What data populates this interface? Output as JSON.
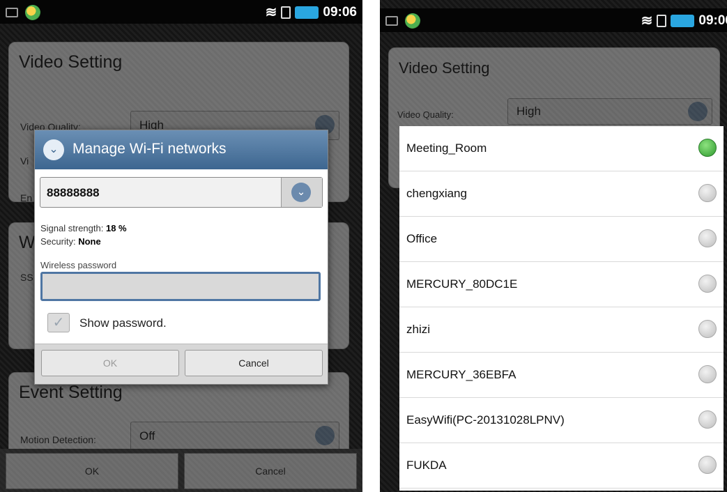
{
  "status_bar": {
    "time": "09:06"
  },
  "left": {
    "background": {
      "video_card_title": "Video Setting",
      "video_quality_label": "Video Quality:",
      "video_quality_value": "High",
      "row_label_partial_1": "Vi",
      "row_label_partial_2": "En",
      "wifi_card_partial": "W",
      "ssid_partial": "SS",
      "event_card_title": "Event Setting",
      "motion_detection_label": "Motion Detection:",
      "motion_detection_value": "Off",
      "ok_label": "OK",
      "cancel_label": "Cancel"
    },
    "dialog": {
      "title": "Manage Wi-Fi networks",
      "selected_network": "88888888",
      "signal_label": "Signal strength:",
      "signal_value": "18 %",
      "security_label": "Security:",
      "security_value": "None",
      "password_label": "Wireless password",
      "password_value": "",
      "show_password_label": "Show password.",
      "ok_label": "OK",
      "cancel_label": "Cancel"
    }
  },
  "right": {
    "background": {
      "video_card_title": "Video Setting",
      "video_quality_label": "Video Quality:",
      "video_quality_value": "High"
    },
    "networks": [
      {
        "name": "Meeting_Room",
        "selected": true
      },
      {
        "name": "chengxiang",
        "selected": false
      },
      {
        "name": "Office",
        "selected": false
      },
      {
        "name": "MERCURY_80DC1E",
        "selected": false
      },
      {
        "name": "zhizi",
        "selected": false
      },
      {
        "name": "MERCURY_36EBFA",
        "selected": false
      },
      {
        "name": "EasyWifi(PC-20131028LPNV)",
        "selected": false
      },
      {
        "name": "FUKDA",
        "selected": false
      }
    ]
  },
  "colors": {
    "dialog_header": "#3d6690",
    "radio_selected": "#2e9a2e",
    "battery": "#2aa6e0"
  },
  "icons": [
    "sd-card-icon",
    "app-icon",
    "wifi-icon",
    "vibrate-icon",
    "battery-icon",
    "chevron-down-icon",
    "checkbox-icon",
    "radio-icon"
  ]
}
